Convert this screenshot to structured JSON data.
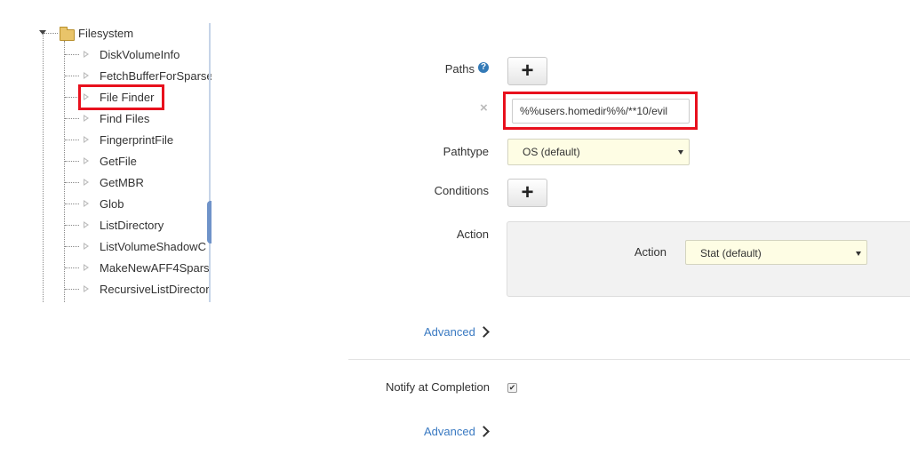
{
  "tree": {
    "root": {
      "label": "Filesystem",
      "icon": "folder-icon"
    },
    "items": [
      {
        "label": "DiskVolumeInfo"
      },
      {
        "label": "FetchBufferForSparse"
      },
      {
        "label": "File Finder"
      },
      {
        "label": "Find Files"
      },
      {
        "label": "FingerprintFile"
      },
      {
        "label": "GetFile"
      },
      {
        "label": "GetMBR"
      },
      {
        "label": "Glob"
      },
      {
        "label": "ListDirectory"
      },
      {
        "label": "ListVolumeShadowC"
      },
      {
        "label": "MakeNewAFF4Spars"
      },
      {
        "label": "RecursiveListDirector"
      }
    ]
  },
  "form": {
    "paths": {
      "label": "Paths",
      "help": "?",
      "add": "+",
      "remove": "×",
      "value": "%%users.homedir%%/**10/evil"
    },
    "pathtype": {
      "label": "Pathtype",
      "selected": "OS (default)"
    },
    "conditions": {
      "label": "Conditions",
      "add": "+"
    },
    "action": {
      "label": "Action",
      "inner_label": "Action",
      "selected": "Stat (default)"
    },
    "advanced1": "Advanced",
    "notify": {
      "label": "Notify at Completion",
      "checked": "✔"
    },
    "advanced2": "Advanced"
  },
  "colors": {
    "highlight": "#e8101d",
    "link": "#3a7ac2",
    "select_bg": "#fefde4"
  }
}
